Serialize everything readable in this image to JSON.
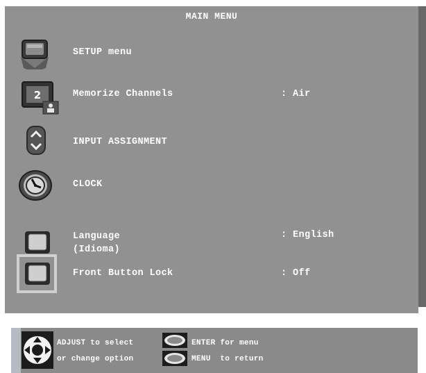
{
  "menu": {
    "title": "MAIN MENU",
    "items": [
      {
        "label": "SETUP menu",
        "value": "",
        "icon": "tv-setup-icon"
      },
      {
        "label": "Memorize Channels",
        "value": ": Air",
        "icon": "channel-memory-icon",
        "icon_text": "2"
      },
      {
        "label": "INPUT ASSIGNMENT",
        "value": "",
        "icon": "input-arrows-icon"
      },
      {
        "label": "CLOCK",
        "value": "",
        "icon": "clock-icon"
      },
      {
        "label": "Language\n(Idioma)",
        "value": ": English",
        "icon": "square-button-icon"
      },
      {
        "label": "Front Button Lock",
        "value": ": Off",
        "icon": "square-button-icon",
        "selected": true
      }
    ]
  },
  "help": {
    "adjust_line1": "ADJUST to select",
    "adjust_line2": "or change option",
    "enter_text": "ENTER for menu",
    "menu_text": "MENU  to return",
    "icons": [
      "dpad-icon",
      "enter-button-icon",
      "menu-button-icon"
    ]
  },
  "colors": {
    "panel": "#919191",
    "shadow": "#686868",
    "highlight": "#d0d0d0",
    "text": "#ffffff"
  }
}
